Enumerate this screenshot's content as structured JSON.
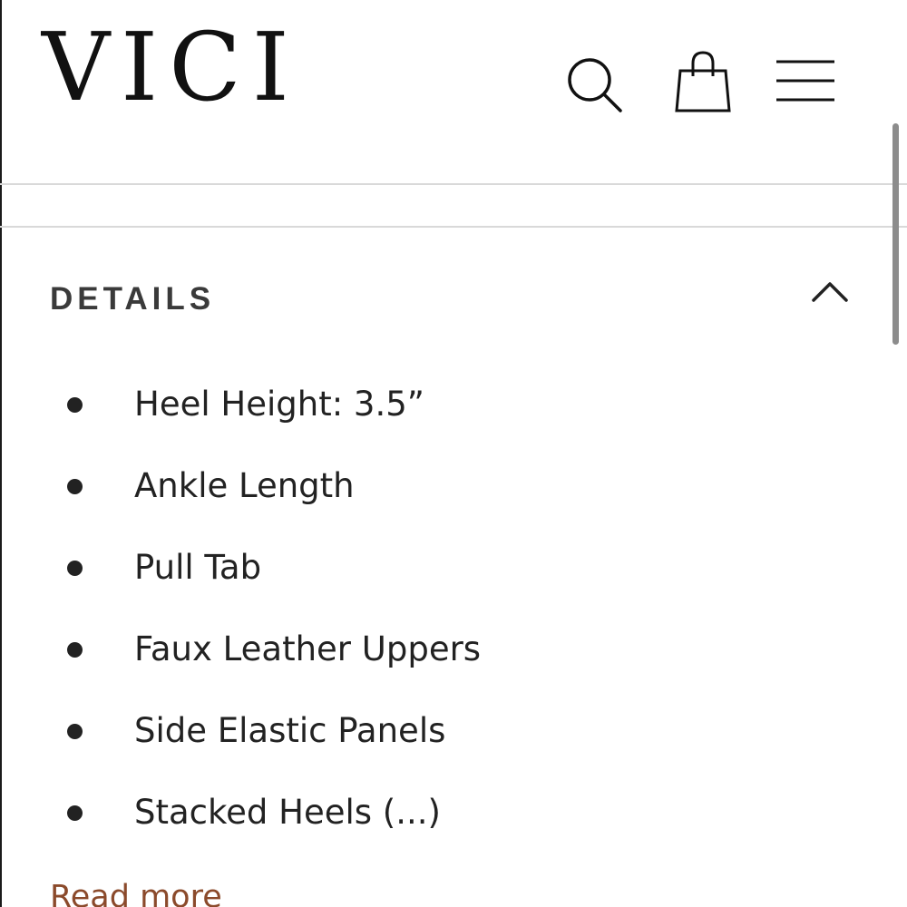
{
  "header": {
    "logo_text": "VICI",
    "icons": [
      "search-icon",
      "shopping-bag-icon",
      "hamburger-menu-icon"
    ]
  },
  "details": {
    "title": "DETAILS",
    "toggle_icon": "chevron-up-icon",
    "items": [
      "Heel Height: 3.5”",
      "Ankle Length",
      "Pull Tab",
      "Faux Leather Uppers",
      "Side Elastic Panels",
      "Stacked Heels  (...)"
    ],
    "read_more_label": "Read more"
  },
  "colors": {
    "text": "#222222",
    "heading": "#3a3a3a",
    "divider": "#d9d9d9",
    "link": "#8b4a2b",
    "scrollbar": "#8c8c8c"
  }
}
